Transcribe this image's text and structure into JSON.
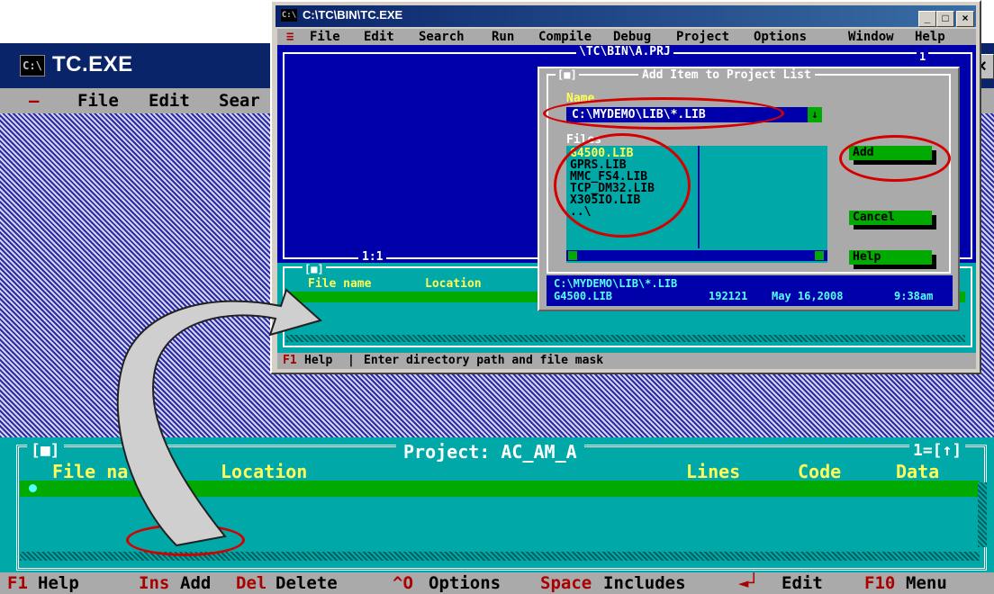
{
  "back_window": {
    "title": "TC.EXE",
    "icon": "console-icon",
    "close_label": "×",
    "menu": {
      "system": "–",
      "file": "File",
      "edit": "Edit",
      "search": "Sear"
    },
    "project_panel": {
      "title": "Project: AC_AM_A",
      "left_control": "[■]",
      "right_control": "1=[↑]",
      "columns": {
        "file_name": "File na",
        "location": "Location",
        "lines": "Lines",
        "code": "Code",
        "data": "Data"
      }
    },
    "status_bar": [
      {
        "key": "F1",
        "label": "Help"
      },
      {
        "key": "Ins",
        "label": "Add"
      },
      {
        "key": "Del",
        "label": "Delete"
      },
      {
        "key": "^O",
        "label": "Options"
      },
      {
        "key": "Space",
        "label": "Includes"
      },
      {
        "key": "◄┘",
        "label": "Edit"
      },
      {
        "key": "F10",
        "label": "Menu"
      }
    ]
  },
  "front_window": {
    "title": "C:\\TC\\BIN\\TC.EXE",
    "icon": "console-icon",
    "window_buttons": {
      "minimize": "_",
      "maximize": "□",
      "close": "×"
    },
    "menu": [
      "≡",
      "File",
      "Edit",
      "Search",
      "Run",
      "Compile",
      "Debug",
      "Project",
      "Options",
      "Window",
      "Help"
    ],
    "editor": {
      "title": "\\TC\\BIN\\A.PRJ",
      "window_number": "1",
      "cursor_position": "1:1"
    },
    "message_panel": {
      "control": "[■]",
      "columns": {
        "file_name": "File name",
        "location": "Location"
      }
    },
    "status": {
      "key": "F1",
      "label": "Help",
      "message": "Enter directory path and file mask"
    }
  },
  "dialog": {
    "title": "Add Item to Project List",
    "control": "[■]",
    "name_label": "Name",
    "name_value": "C:\\MYDEMO\\LIB\\*.LIB",
    "dropdown_arrow": "↓",
    "files_label": "Files",
    "files": [
      "G4500.LIB",
      "GPRS.LIB",
      "MMC_FS4.LIB",
      "TCP_DM32.LIB",
      "X305IO.LIB",
      "..\\"
    ],
    "buttons": {
      "add": "Add",
      "cancel": "Cancel",
      "help": "Help"
    },
    "info_path": "C:\\MYDEMO\\LIB\\*.LIB",
    "info_file": "G4500.LIB",
    "info_size": "192121",
    "info_date": "May 16,2008",
    "info_time": "9:38am"
  },
  "colors": {
    "dos_blue": "#0000aa",
    "dos_cyan": "#00a8a8",
    "dos_green": "#00aa00",
    "dos_yellow": "#ffff55",
    "hotkey_red": "#aa0000",
    "annotation_red": "#d40000",
    "titlebar_blue": "#0a246a"
  }
}
